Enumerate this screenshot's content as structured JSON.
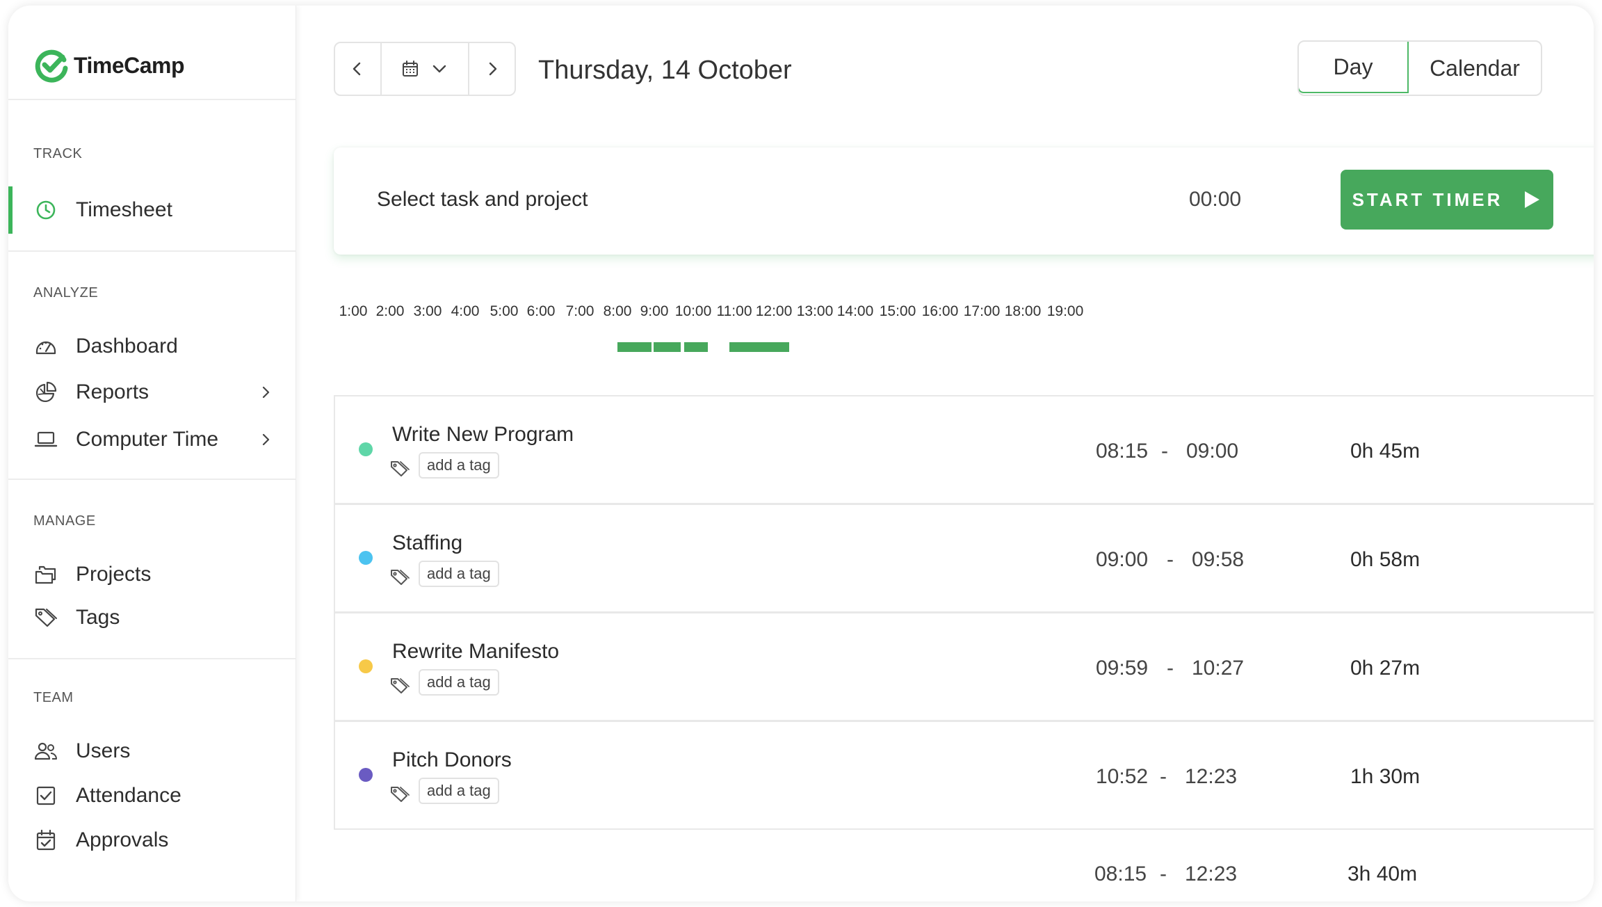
{
  "app": {
    "logo_text": "TimeCamp",
    "brand_color": "#3cb55a"
  },
  "sidebar": {
    "sections": [
      {
        "label": "TRACK",
        "items": [
          {
            "label": "Timesheet",
            "icon": "clock-icon",
            "active": true
          }
        ]
      },
      {
        "label": "ANALYZE",
        "items": [
          {
            "label": "Dashboard",
            "icon": "gauge-icon"
          },
          {
            "label": "Reports",
            "icon": "pie-chart-icon",
            "has_submenu": true
          },
          {
            "label": "Computer Time",
            "icon": "laptop-icon",
            "has_submenu": true
          }
        ]
      },
      {
        "label": "MANAGE",
        "items": [
          {
            "label": "Projects",
            "icon": "folders-icon"
          },
          {
            "label": "Tags",
            "icon": "tag-icon"
          }
        ]
      },
      {
        "label": "TEAM",
        "items": [
          {
            "label": "Users",
            "icon": "users-icon"
          },
          {
            "label": "Attendance",
            "icon": "checkbox-icon"
          },
          {
            "label": "Approvals",
            "icon": "calendar-check-icon"
          }
        ]
      }
    ]
  },
  "header": {
    "date_title": "Thursday, 14 October",
    "view_toggle": {
      "day": "Day",
      "calendar": "Calendar",
      "selected": "Day"
    }
  },
  "timer": {
    "task_placeholder": "Select task and project",
    "clock": "00:00",
    "start_label": "START TIMER"
  },
  "timeline": {
    "hours": [
      "1:00",
      "2:00",
      "3:00",
      "4:00",
      "5:00",
      "6:00",
      "7:00",
      "8:00",
      "9:00",
      "10:00",
      "11:00",
      "12:00",
      "13:00",
      "14:00",
      "15:00",
      "16:00",
      "17:00",
      "18:00",
      "19:00"
    ]
  },
  "entries": [
    {
      "task": "Write New Program",
      "color": "#5fd6a8",
      "tag": "add a tag",
      "start": "08:15",
      "end": "09:00",
      "duration": "0h 45m"
    },
    {
      "task": "Staffing",
      "color": "#4cc3f0",
      "tag": "add a tag",
      "start": "09:00",
      "end": "09:58",
      "duration": "0h 58m"
    },
    {
      "task": "Rewrite Manifesto",
      "color": "#f7c948",
      "tag": "add a tag",
      "start": "09:59",
      "end": "10:27",
      "duration": "0h 27m"
    },
    {
      "task": "Pitch Donors",
      "color": "#6a5bc2",
      "tag": "add a tag",
      "start": "10:52",
      "end": "12:23",
      "duration": "1h 30m"
    }
  ],
  "total": {
    "start": "08:15",
    "end": "12:23",
    "duration": "3h 40m"
  },
  "separator": "-"
}
